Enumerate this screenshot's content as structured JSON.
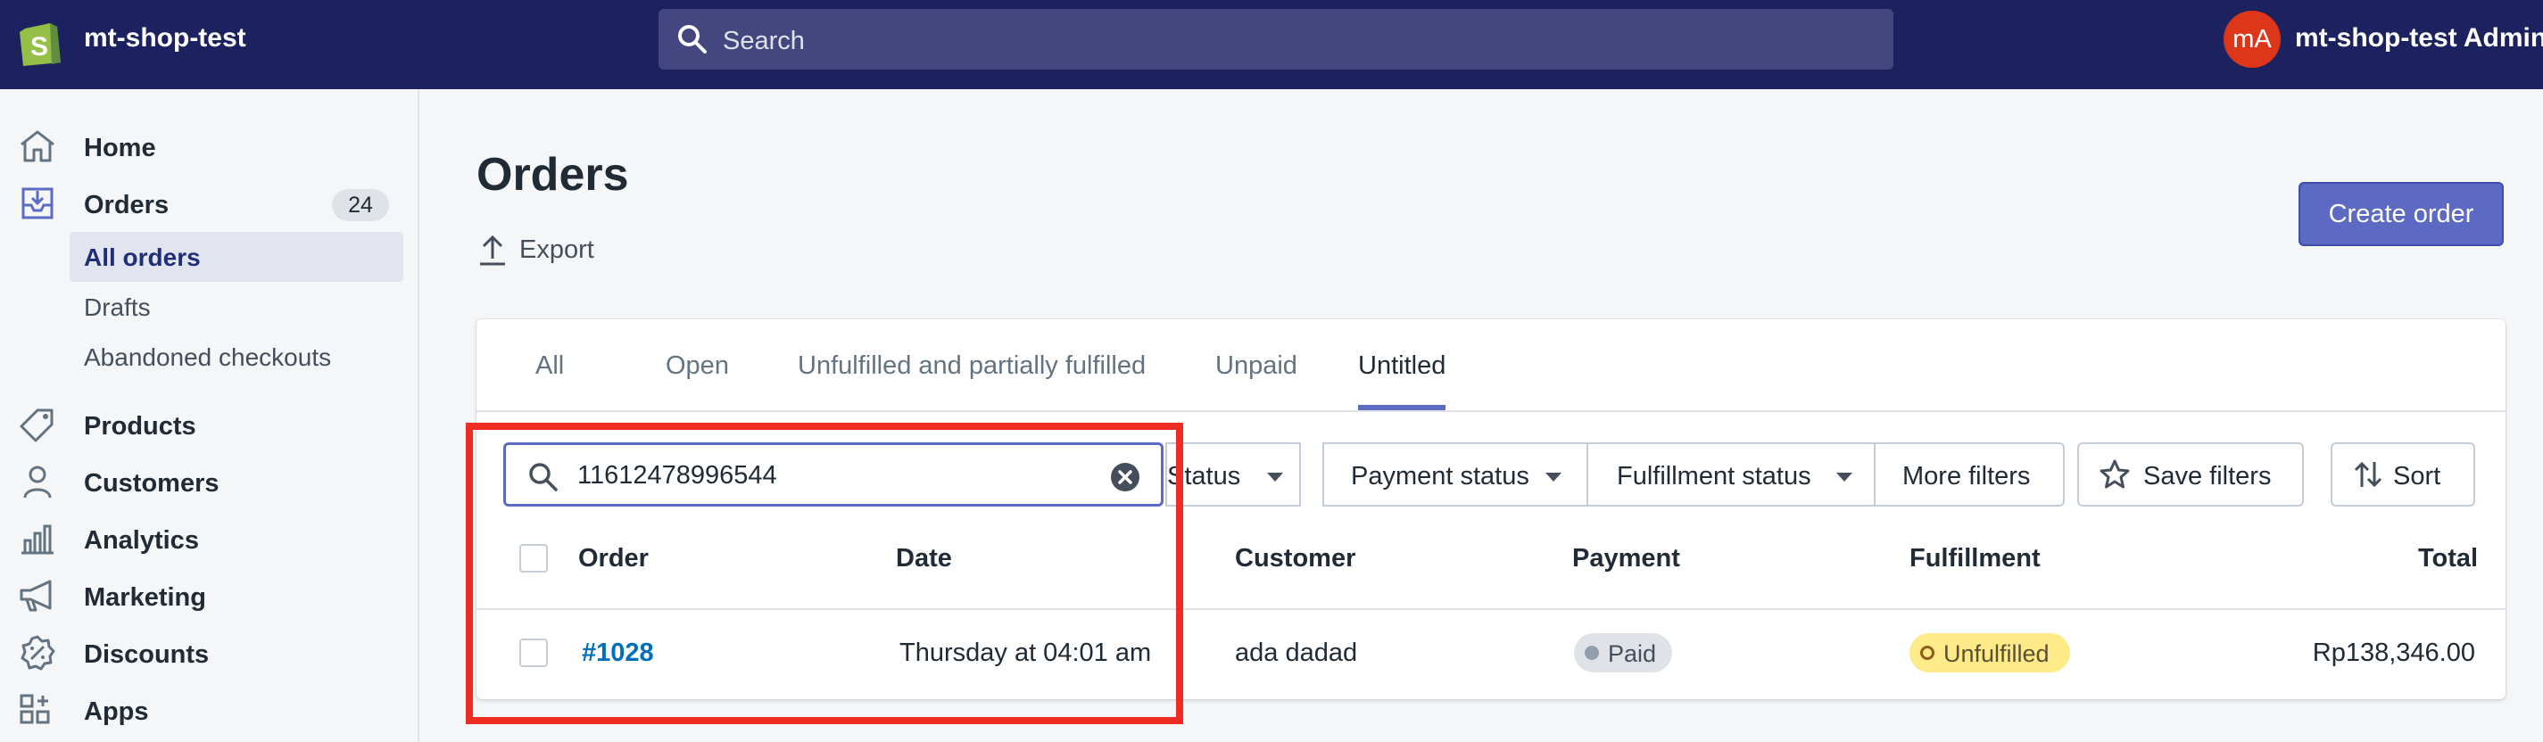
{
  "topbar": {
    "shop_name": "mt-shop-test",
    "search_placeholder": "Search",
    "avatar_initials": "mA",
    "admin_name": "mt-shop-test Admin",
    "brand_color": "#1c2260"
  },
  "sidebar": {
    "items": [
      {
        "label": "Home",
        "icon": "home-icon"
      },
      {
        "label": "Orders",
        "icon": "orders-icon",
        "badge": "24"
      },
      {
        "label": "Products",
        "icon": "tag-icon"
      },
      {
        "label": "Customers",
        "icon": "person-icon"
      },
      {
        "label": "Analytics",
        "icon": "bar-chart-icon"
      },
      {
        "label": "Marketing",
        "icon": "megaphone-icon"
      },
      {
        "label": "Discounts",
        "icon": "discount-icon"
      },
      {
        "label": "Apps",
        "icon": "apps-icon"
      }
    ],
    "order_subitems": [
      "All orders",
      "Drafts",
      "Abandoned checkouts"
    ]
  },
  "main": {
    "title": "Orders",
    "export_label": "Export",
    "create_label": "Create order",
    "tabs": [
      "All",
      "Open",
      "Unfulfilled and partially fulfilled",
      "Unpaid",
      "Untitled"
    ],
    "active_tab": "Untitled",
    "filter_value": "11612478996544",
    "filters": [
      "Status",
      "Payment status",
      "Fulfillment status",
      "More filters"
    ],
    "save_filters_label": "Save filters",
    "sort_label": "Sort",
    "columns": [
      "Order",
      "Date",
      "Customer",
      "Payment",
      "Fulfillment",
      "Total"
    ],
    "rows": [
      {
        "order": "#1028",
        "date": "Thursday at 04:01 am",
        "customer": "ada dadad",
        "payment": "Paid",
        "fulfillment": "Unfulfilled",
        "total": "Rp138,346.00"
      }
    ]
  },
  "colors": {
    "accent": "#5c6ac4",
    "highlight": "#ee2c24",
    "paid_badge": "#dfe3e8",
    "unfulfilled_badge": "#ffea8a"
  }
}
